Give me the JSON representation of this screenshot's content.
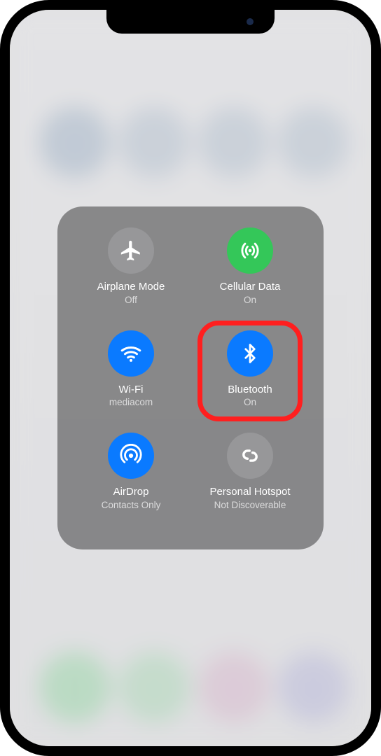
{
  "panel": {
    "airplane": {
      "title": "Airplane Mode",
      "sub": "Off"
    },
    "cellular": {
      "title": "Cellular Data",
      "sub": "On"
    },
    "wifi": {
      "title": "Wi-Fi",
      "sub": "mediacom"
    },
    "bluetooth": {
      "title": "Bluetooth",
      "sub": "On"
    },
    "airdrop": {
      "title": "AirDrop",
      "sub": "Contacts Only"
    },
    "hotspot": {
      "title": "Personal Hotspot",
      "sub": "Not Discoverable"
    }
  }
}
